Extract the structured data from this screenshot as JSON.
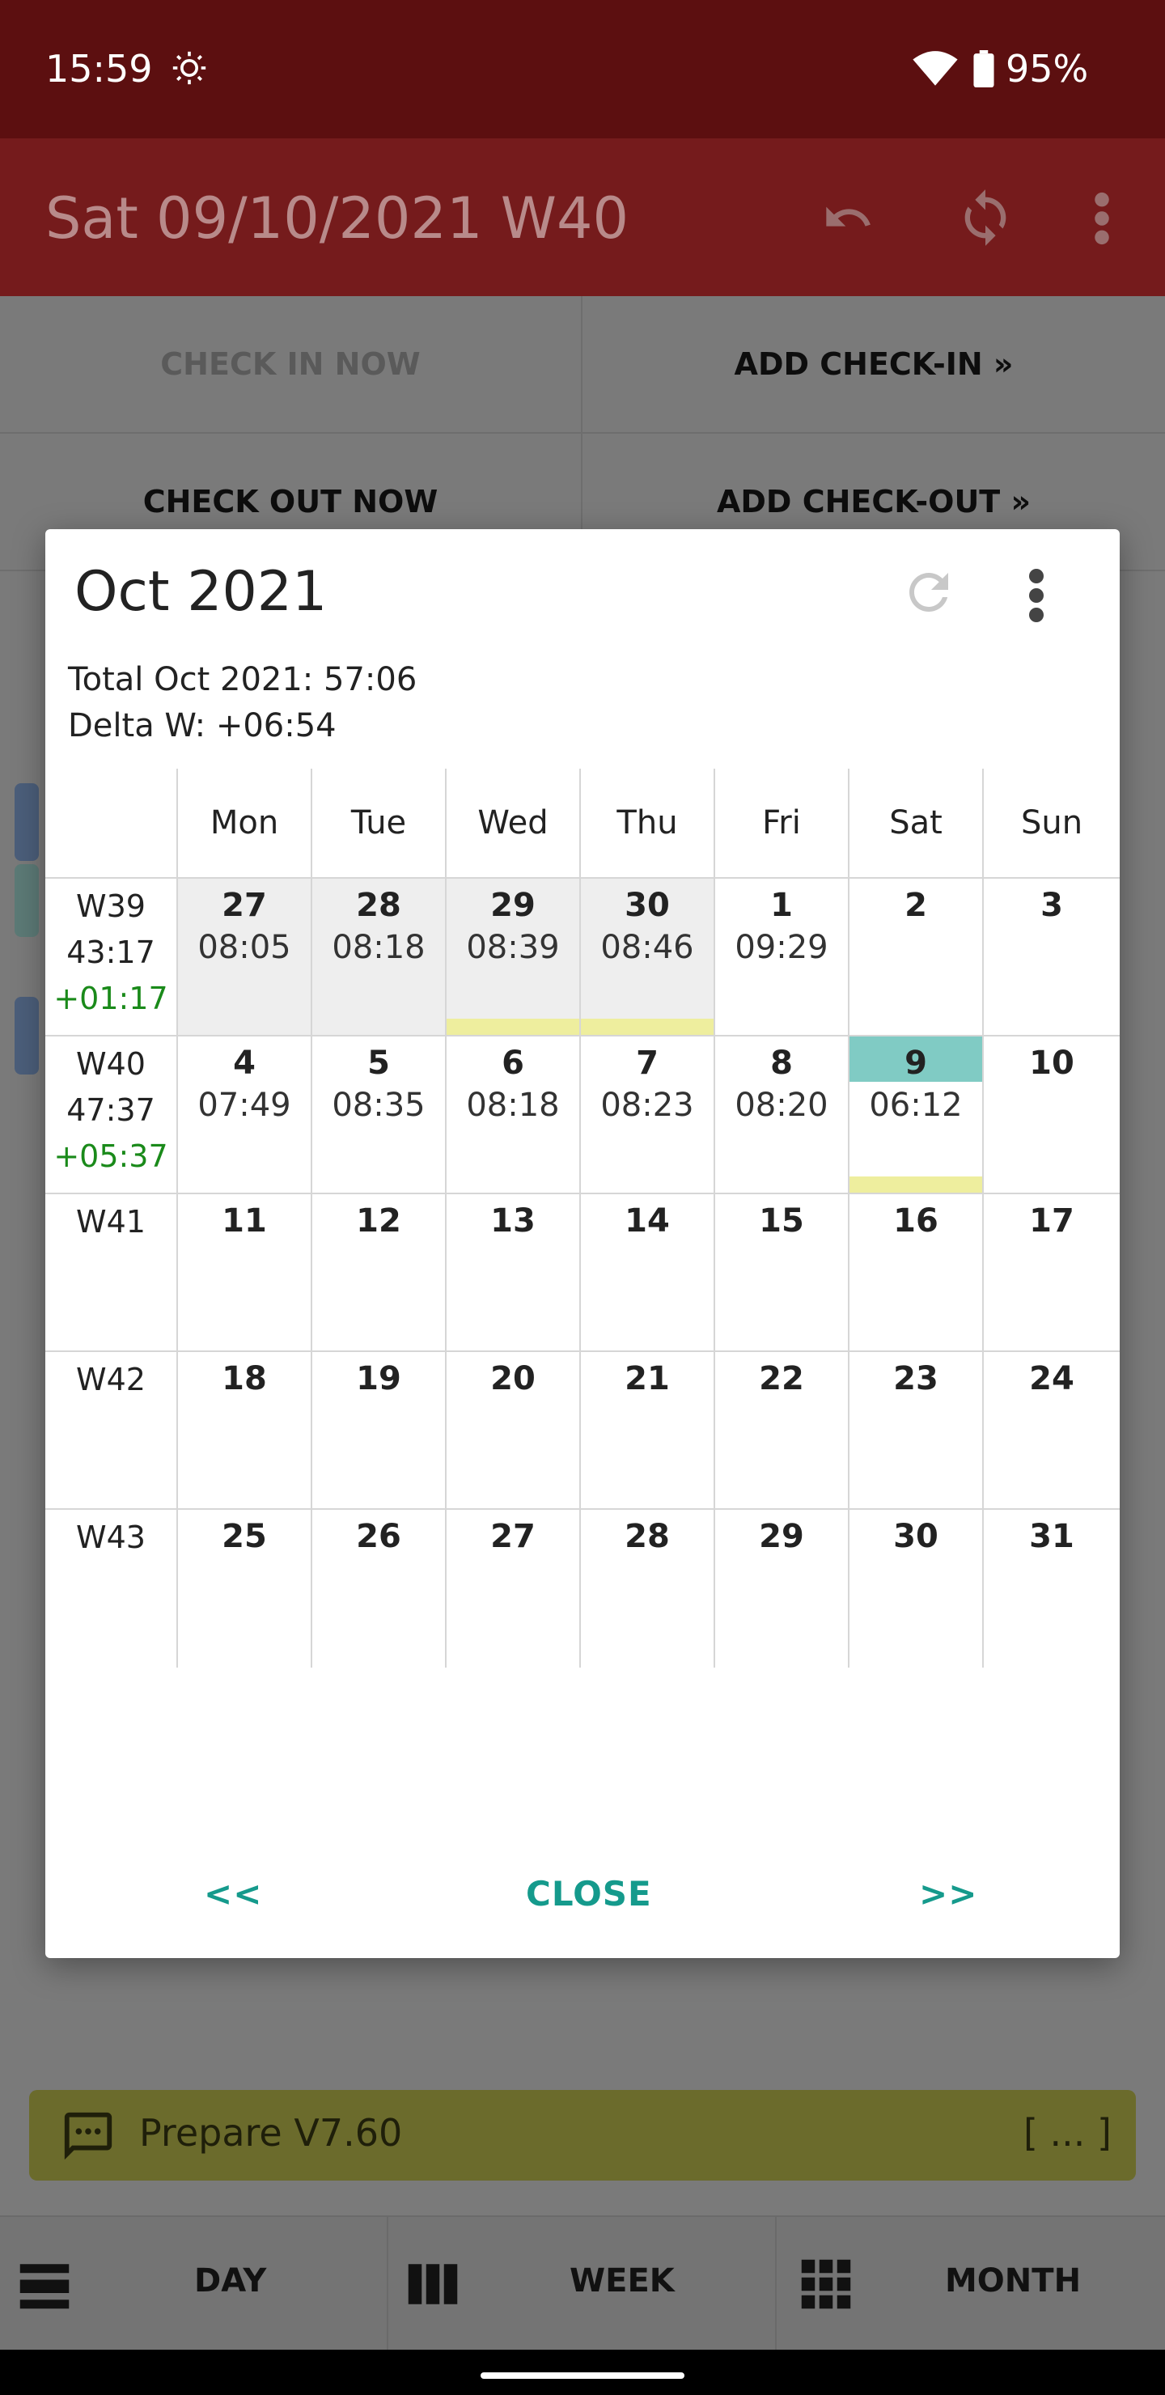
{
  "status": {
    "time": "15:59",
    "battery": "95%",
    "icons": [
      "brightness-icon",
      "wifi-icon",
      "battery-icon"
    ]
  },
  "appbar": {
    "title": "Sat 09/10/2021 W40",
    "icons": [
      "undo-icon",
      "sync-icon",
      "more-vert-icon"
    ]
  },
  "background_buttons": {
    "check_in_now": "CHECK IN NOW",
    "add_check_in": "ADD CHECK-IN »",
    "check_out_now": "CHECK OUT NOW",
    "add_check_out": "ADD CHECK-OUT »"
  },
  "notification": {
    "message": "Prepare V7.60",
    "more": "[ ... ]"
  },
  "bottom_nav": {
    "day": "DAY",
    "week": "WEEK",
    "month": "MONTH"
  },
  "dialog": {
    "title": "Oct 2021",
    "total": "Total Oct 2021: 57:06",
    "delta": "Delta W: +06:54",
    "weekdays": [
      "Mon",
      "Tue",
      "Wed",
      "Thu",
      "Fri",
      "Sat",
      "Sun"
    ],
    "weeks": [
      {
        "week": "W39",
        "total": "43:17",
        "delta": "+01:17",
        "days": [
          {
            "day": "27",
            "hours": "08:05",
            "other_month": true
          },
          {
            "day": "28",
            "hours": "08:18",
            "other_month": true
          },
          {
            "day": "29",
            "hours": "08:39",
            "other_month": true,
            "marked": true
          },
          {
            "day": "30",
            "hours": "08:46",
            "other_month": true,
            "marked": true
          },
          {
            "day": "1",
            "hours": "09:29"
          },
          {
            "day": "2",
            "hours": ""
          },
          {
            "day": "3",
            "hours": ""
          }
        ]
      },
      {
        "week": "W40",
        "total": "47:37",
        "delta": "+05:37",
        "days": [
          {
            "day": "4",
            "hours": "07:49"
          },
          {
            "day": "5",
            "hours": "08:35"
          },
          {
            "day": "6",
            "hours": "08:18"
          },
          {
            "day": "7",
            "hours": "08:23"
          },
          {
            "day": "8",
            "hours": "08:20"
          },
          {
            "day": "9",
            "hours": "06:12",
            "today": true,
            "marked": true
          },
          {
            "day": "10",
            "hours": ""
          }
        ]
      },
      {
        "week": "W41",
        "total": "",
        "delta": "",
        "days": [
          {
            "day": "11",
            "hours": ""
          },
          {
            "day": "12",
            "hours": ""
          },
          {
            "day": "13",
            "hours": ""
          },
          {
            "day": "14",
            "hours": ""
          },
          {
            "day": "15",
            "hours": ""
          },
          {
            "day": "16",
            "hours": ""
          },
          {
            "day": "17",
            "hours": ""
          }
        ]
      },
      {
        "week": "W42",
        "total": "",
        "delta": "",
        "days": [
          {
            "day": "18",
            "hours": ""
          },
          {
            "day": "19",
            "hours": ""
          },
          {
            "day": "20",
            "hours": ""
          },
          {
            "day": "21",
            "hours": ""
          },
          {
            "day": "22",
            "hours": ""
          },
          {
            "day": "23",
            "hours": ""
          },
          {
            "day": "24",
            "hours": ""
          }
        ]
      },
      {
        "week": "W43",
        "total": "",
        "delta": "",
        "days": [
          {
            "day": "25",
            "hours": ""
          },
          {
            "day": "26",
            "hours": ""
          },
          {
            "day": "27",
            "hours": ""
          },
          {
            "day": "28",
            "hours": ""
          },
          {
            "day": "29",
            "hours": ""
          },
          {
            "day": "30",
            "hours": ""
          },
          {
            "day": "31",
            "hours": ""
          }
        ]
      }
    ],
    "actions": {
      "prev": "<<",
      "close": "CLOSE",
      "next": ">>"
    },
    "colors": {
      "today": "#80cbc4",
      "marked": "#eeee9e",
      "other_month": "#eeeeee",
      "accent": "#159a8c",
      "positive_delta": "#1a8a1a"
    }
  }
}
